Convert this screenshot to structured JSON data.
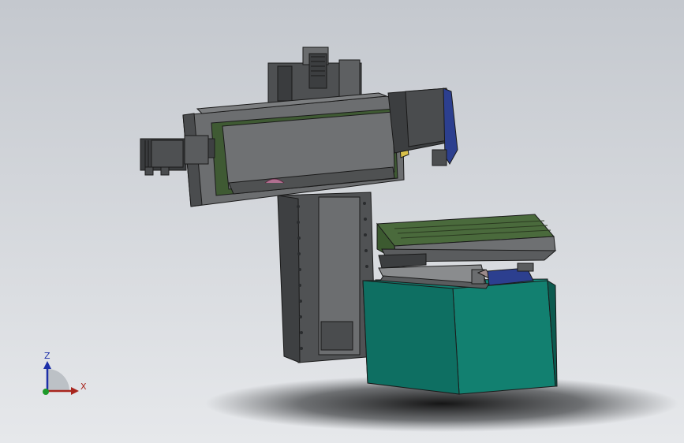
{
  "viewport": {
    "background_top": "#c4c8ce",
    "background_bottom": "#e6e8eb"
  },
  "model": {
    "colors": {
      "body_dark": "#4f5152",
      "body_mid": "#6e7072",
      "body_light": "#8c8e90",
      "outline": "#1a1a1a",
      "green_trim": "#3c5a30",
      "accent_blue": "#2c3f8f",
      "accent_yellow": "#d8c04a",
      "accent_pink": "#b07090",
      "teal_base": "#127a6c",
      "teal_side": "#0e6458",
      "table_green": "#4a6a3c"
    }
  },
  "triad": {
    "z_label": "Z",
    "x_label": "X",
    "z_color": "#1c2fa8",
    "x_color": "#a8261e",
    "y_color": "#1e9a2a"
  }
}
